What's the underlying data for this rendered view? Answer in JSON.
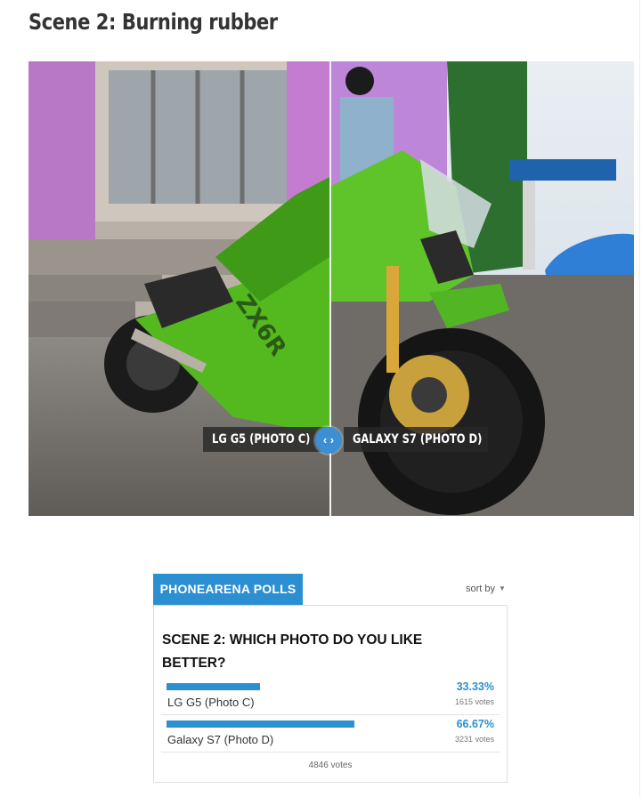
{
  "article": {
    "heading": "Scene 2: Burning rubber"
  },
  "comparison": {
    "left_label": "LG G5 (PHOTO C)",
    "right_label": "GALAXY S7 (PHOTO D)",
    "handle_icon": "left-right-arrows-icon",
    "handle_glyph": "‹ ›"
  },
  "poll": {
    "tab_label": "PHONEARENA POLLS",
    "sort_label": "sort by",
    "question": "SCENE 2: WHICH PHOTO DO YOU LIKE BETTER?",
    "accent_color": "#2b8fd2",
    "options": [
      {
        "label": "LG G5 (Photo C)",
        "percent": "33.33%",
        "votes": "1615 votes",
        "share": 0.3333
      },
      {
        "label": "Galaxy S7 (Photo D)",
        "percent": "66.67%",
        "votes": "3231 votes",
        "share": 0.6667
      }
    ],
    "total_votes": "4846 votes"
  }
}
